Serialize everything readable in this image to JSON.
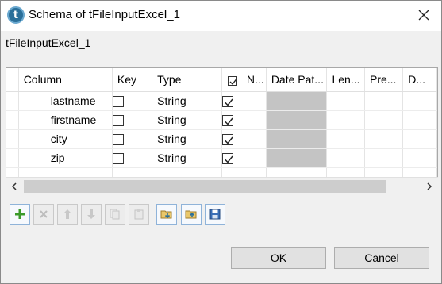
{
  "window": {
    "title": "Schema of tFileInputExcel_1",
    "close_icon": "close-icon",
    "app_icon_letter": "t"
  },
  "subtitle": "tFileInputExcel_1",
  "table": {
    "headers": {
      "column": "Column",
      "key": "Key",
      "type": "Type",
      "nullable": "N...",
      "date_pattern": "Date Pat...",
      "length": "Len...",
      "precision": "Pre...",
      "default": "D..."
    },
    "rows": [
      {
        "column": "lastname",
        "key": false,
        "type": "String",
        "nullable": true,
        "date_pattern": ""
      },
      {
        "column": "firstname",
        "key": false,
        "type": "String",
        "nullable": true,
        "date_pattern": ""
      },
      {
        "column": "city",
        "key": false,
        "type": "String",
        "nullable": true,
        "date_pattern": ""
      },
      {
        "column": "zip",
        "key": false,
        "type": "String",
        "nullable": true,
        "date_pattern": ""
      }
    ],
    "nullable_header_checked": true
  },
  "toolbar": {
    "buttons": [
      {
        "icon": "add-icon",
        "enabled": true
      },
      {
        "icon": "remove-icon",
        "enabled": false
      },
      {
        "icon": "move-up-icon",
        "enabled": false
      },
      {
        "icon": "move-down-icon",
        "enabled": false
      },
      {
        "icon": "copy-icon",
        "enabled": false
      },
      {
        "icon": "paste-icon",
        "enabled": false
      },
      {
        "icon": "import-icon",
        "enabled": true
      },
      {
        "icon": "export-icon",
        "enabled": true
      },
      {
        "icon": "save-icon",
        "enabled": true
      }
    ]
  },
  "buttons": {
    "ok": "OK",
    "cancel": "Cancel"
  },
  "colors": {
    "accent_blue": "#2a6f9a",
    "add_green": "#3a9a2a",
    "date_pattern_fill": "#c4c4c4"
  }
}
